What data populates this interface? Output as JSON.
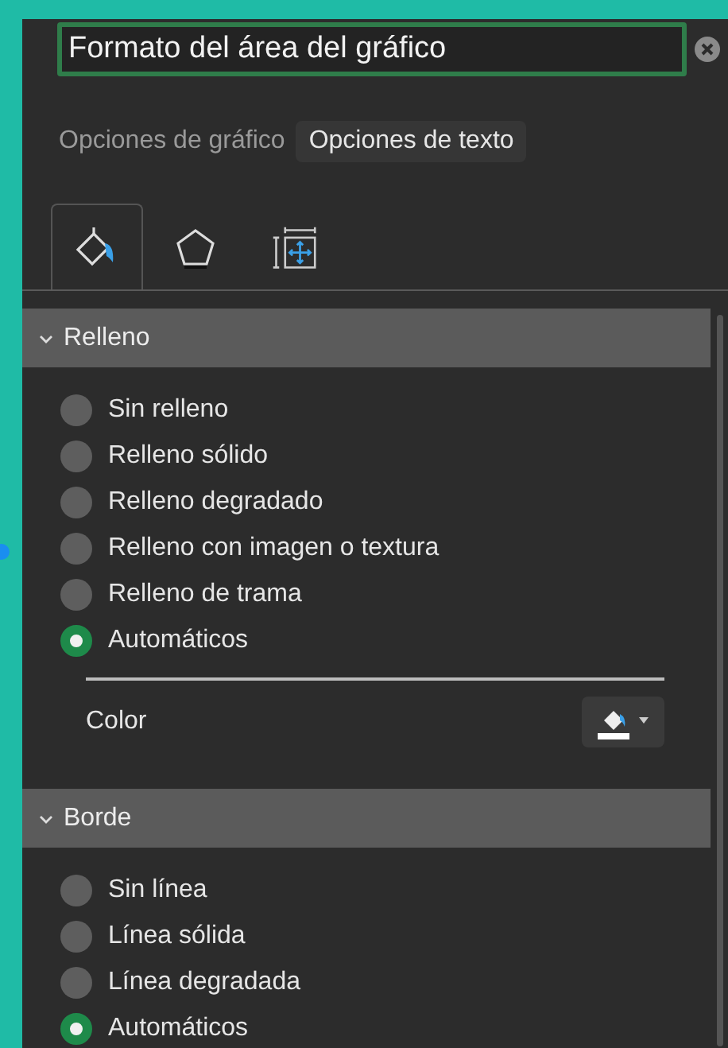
{
  "title_field": {
    "value": "Formato del área del gráfico"
  },
  "tabs": [
    {
      "label": "Opciones de gráfico",
      "selected": false
    },
    {
      "label": "Opciones de texto",
      "selected": true
    }
  ],
  "icon_tabs": [
    {
      "kind": "fill",
      "selected": true
    },
    {
      "kind": "shape",
      "selected": false
    },
    {
      "kind": "size",
      "selected": false
    }
  ],
  "sections": [
    {
      "title": "Relleno",
      "expanded": true,
      "options": [
        {
          "label": "Sin relleno",
          "selected": false
        },
        {
          "label": "Relleno sólido",
          "selected": false
        },
        {
          "label": "Relleno degradado",
          "selected": false
        },
        {
          "label": "Relleno con imagen o textura",
          "selected": false
        },
        {
          "label": "Relleno de trama",
          "selected": false
        },
        {
          "label": "Automáticos",
          "selected": true
        }
      ],
      "color_row": {
        "label": "Color"
      }
    },
    {
      "title": "Borde",
      "expanded": true,
      "options": [
        {
          "label": "Sin línea",
          "selected": false
        },
        {
          "label": "Línea sólida",
          "selected": false
        },
        {
          "label": "Línea degradada",
          "selected": false
        },
        {
          "label": "Automáticos",
          "selected": true
        }
      ]
    }
  ]
}
